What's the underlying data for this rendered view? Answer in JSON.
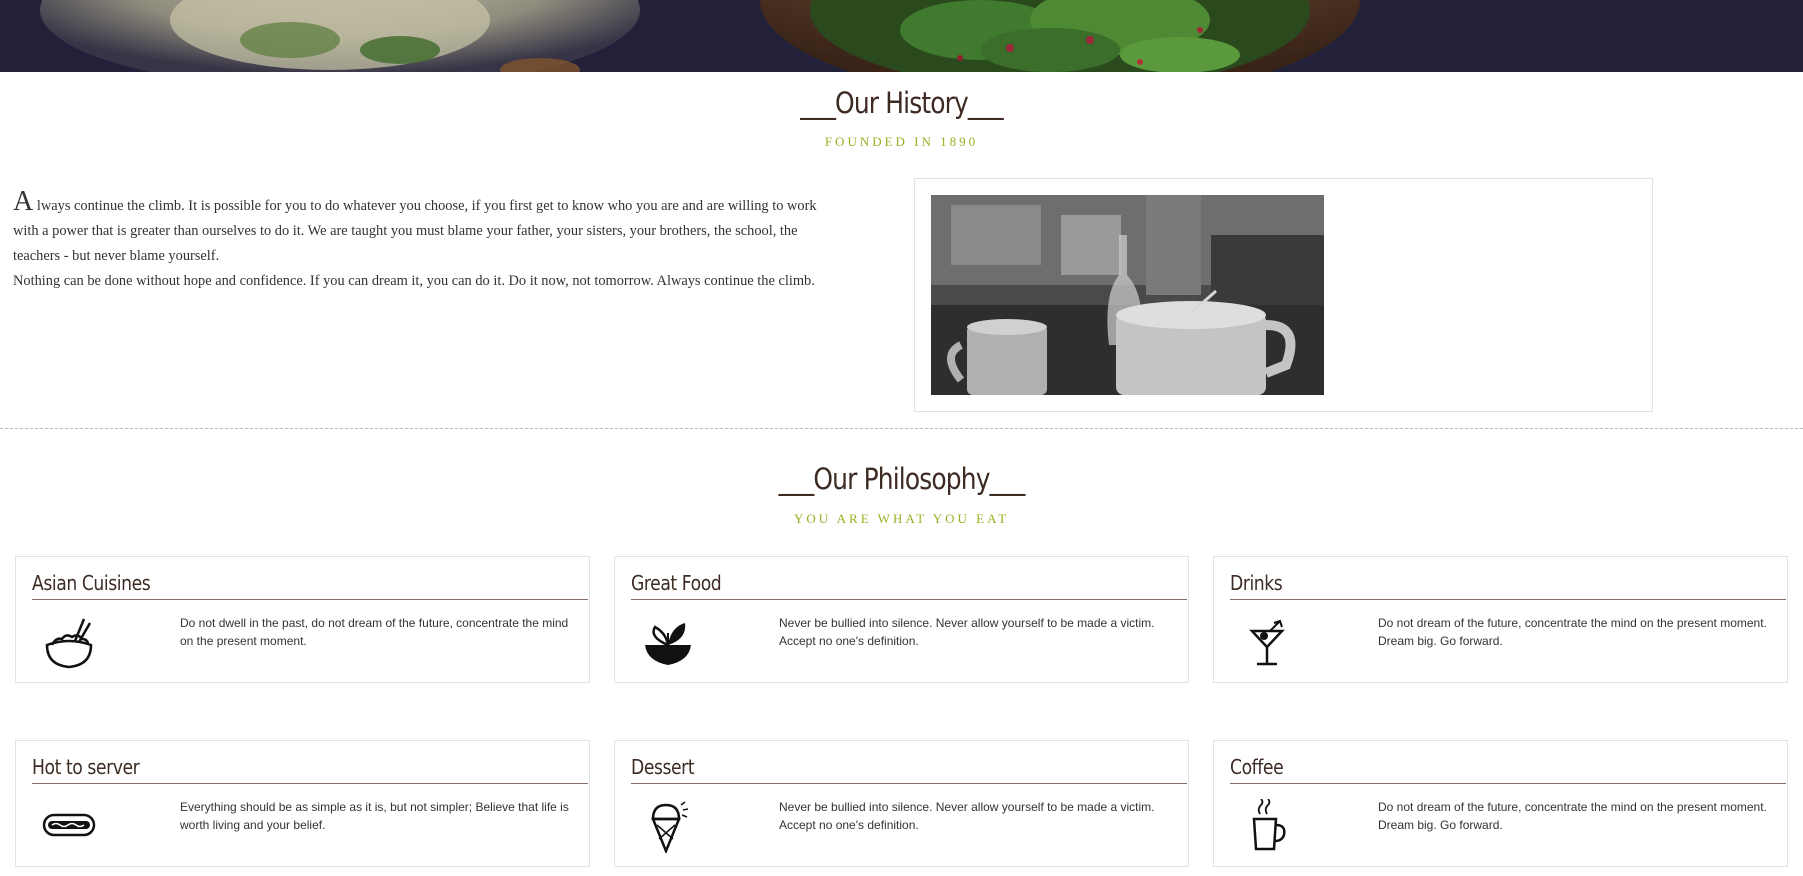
{
  "history": {
    "title": "___Our History___",
    "subtitle": "FOUNDED IN 1890",
    "dropcap": "A",
    "paragraph1": "lways continue the climb. It is possible for you to do whatever you choose, if you first get to know who you are and are willing to work with a power that is greater than ourselves to do it. We are taught you must blame your father, your sisters, your brothers, the school, the teachers - but never blame yourself.",
    "paragraph2": "Nothing can be done without hope and confidence. If you can dream it, you can do it. Do it now, not tomorrow. Always continue the climb."
  },
  "philosophy": {
    "title": "___Our Philosophy___",
    "subtitle": "YOU ARE WHAT YOU EAT",
    "cards": [
      {
        "title": "Asian Cuisines",
        "icon": "rice-bowl-icon",
        "text": "Do not dwell in the past, do not dream of the future, concentrate the mind on the present moment."
      },
      {
        "title": "Great Food",
        "icon": "salad-bowl-icon",
        "text": "Never be bullied into silence. Never allow yourself to be made a victim. Accept no one's definition."
      },
      {
        "title": "Drinks",
        "icon": "cocktail-icon",
        "text": "Do not dream of the future, concentrate the mind on the present moment. Dream big. Go forward."
      },
      {
        "title": "Hot to server",
        "icon": "hotdog-icon",
        "text": "Everything should be as simple as it is, but not simpler; Believe that life is worth living and your belief."
      },
      {
        "title": "Dessert",
        "icon": "ice-cream-icon",
        "text": "Never be bullied into silence. Never allow yourself to be made a victim. Accept no one's definition."
      },
      {
        "title": "Coffee",
        "icon": "coffee-cup-icon",
        "text": "Do not dream of the future, concentrate the mind on the present moment. Dream big. Go forward."
      }
    ]
  },
  "colors": {
    "title": "#3d2b24",
    "accent": "#9bb021",
    "hero_bg": "#23203a",
    "card_rule": "#8a6a66"
  }
}
